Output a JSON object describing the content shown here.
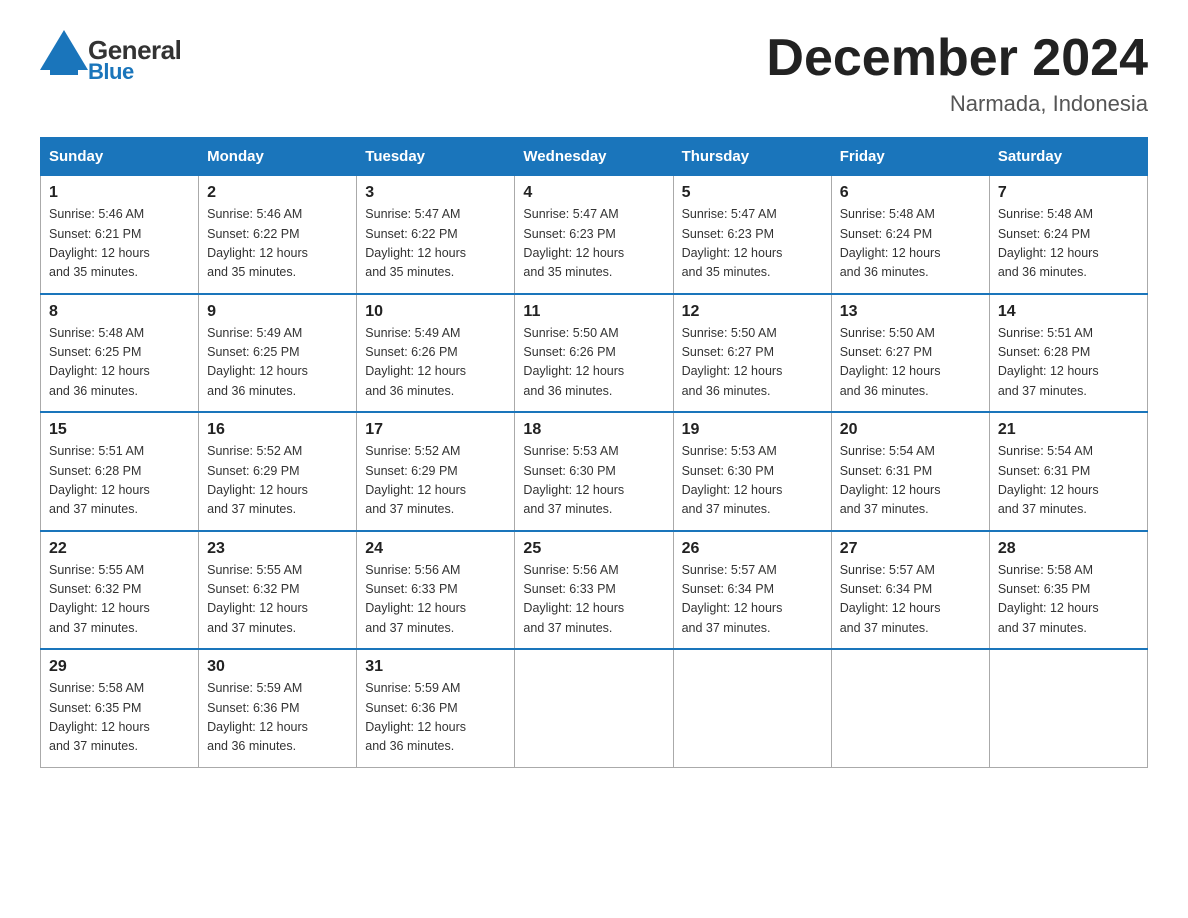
{
  "header": {
    "logo_general": "General",
    "logo_blue": "Blue",
    "month_title": "December 2024",
    "location": "Narmada, Indonesia"
  },
  "days_of_week": [
    "Sunday",
    "Monday",
    "Tuesday",
    "Wednesday",
    "Thursday",
    "Friday",
    "Saturday"
  ],
  "weeks": [
    [
      {
        "day": 1,
        "sunrise": "5:46 AM",
        "sunset": "6:21 PM",
        "daylight": "12 hours and 35 minutes."
      },
      {
        "day": 2,
        "sunrise": "5:46 AM",
        "sunset": "6:22 PM",
        "daylight": "12 hours and 35 minutes."
      },
      {
        "day": 3,
        "sunrise": "5:47 AM",
        "sunset": "6:22 PM",
        "daylight": "12 hours and 35 minutes."
      },
      {
        "day": 4,
        "sunrise": "5:47 AM",
        "sunset": "6:23 PM",
        "daylight": "12 hours and 35 minutes."
      },
      {
        "day": 5,
        "sunrise": "5:47 AM",
        "sunset": "6:23 PM",
        "daylight": "12 hours and 35 minutes."
      },
      {
        "day": 6,
        "sunrise": "5:48 AM",
        "sunset": "6:24 PM",
        "daylight": "12 hours and 36 minutes."
      },
      {
        "day": 7,
        "sunrise": "5:48 AM",
        "sunset": "6:24 PM",
        "daylight": "12 hours and 36 minutes."
      }
    ],
    [
      {
        "day": 8,
        "sunrise": "5:48 AM",
        "sunset": "6:25 PM",
        "daylight": "12 hours and 36 minutes."
      },
      {
        "day": 9,
        "sunrise": "5:49 AM",
        "sunset": "6:25 PM",
        "daylight": "12 hours and 36 minutes."
      },
      {
        "day": 10,
        "sunrise": "5:49 AM",
        "sunset": "6:26 PM",
        "daylight": "12 hours and 36 minutes."
      },
      {
        "day": 11,
        "sunrise": "5:50 AM",
        "sunset": "6:26 PM",
        "daylight": "12 hours and 36 minutes."
      },
      {
        "day": 12,
        "sunrise": "5:50 AM",
        "sunset": "6:27 PM",
        "daylight": "12 hours and 36 minutes."
      },
      {
        "day": 13,
        "sunrise": "5:50 AM",
        "sunset": "6:27 PM",
        "daylight": "12 hours and 36 minutes."
      },
      {
        "day": 14,
        "sunrise": "5:51 AM",
        "sunset": "6:28 PM",
        "daylight": "12 hours and 37 minutes."
      }
    ],
    [
      {
        "day": 15,
        "sunrise": "5:51 AM",
        "sunset": "6:28 PM",
        "daylight": "12 hours and 37 minutes."
      },
      {
        "day": 16,
        "sunrise": "5:52 AM",
        "sunset": "6:29 PM",
        "daylight": "12 hours and 37 minutes."
      },
      {
        "day": 17,
        "sunrise": "5:52 AM",
        "sunset": "6:29 PM",
        "daylight": "12 hours and 37 minutes."
      },
      {
        "day": 18,
        "sunrise": "5:53 AM",
        "sunset": "6:30 PM",
        "daylight": "12 hours and 37 minutes."
      },
      {
        "day": 19,
        "sunrise": "5:53 AM",
        "sunset": "6:30 PM",
        "daylight": "12 hours and 37 minutes."
      },
      {
        "day": 20,
        "sunrise": "5:54 AM",
        "sunset": "6:31 PM",
        "daylight": "12 hours and 37 minutes."
      },
      {
        "day": 21,
        "sunrise": "5:54 AM",
        "sunset": "6:31 PM",
        "daylight": "12 hours and 37 minutes."
      }
    ],
    [
      {
        "day": 22,
        "sunrise": "5:55 AM",
        "sunset": "6:32 PM",
        "daylight": "12 hours and 37 minutes."
      },
      {
        "day": 23,
        "sunrise": "5:55 AM",
        "sunset": "6:32 PM",
        "daylight": "12 hours and 37 minutes."
      },
      {
        "day": 24,
        "sunrise": "5:56 AM",
        "sunset": "6:33 PM",
        "daylight": "12 hours and 37 minutes."
      },
      {
        "day": 25,
        "sunrise": "5:56 AM",
        "sunset": "6:33 PM",
        "daylight": "12 hours and 37 minutes."
      },
      {
        "day": 26,
        "sunrise": "5:57 AM",
        "sunset": "6:34 PM",
        "daylight": "12 hours and 37 minutes."
      },
      {
        "day": 27,
        "sunrise": "5:57 AM",
        "sunset": "6:34 PM",
        "daylight": "12 hours and 37 minutes."
      },
      {
        "day": 28,
        "sunrise": "5:58 AM",
        "sunset": "6:35 PM",
        "daylight": "12 hours and 37 minutes."
      }
    ],
    [
      {
        "day": 29,
        "sunrise": "5:58 AM",
        "sunset": "6:35 PM",
        "daylight": "12 hours and 37 minutes."
      },
      {
        "day": 30,
        "sunrise": "5:59 AM",
        "sunset": "6:36 PM",
        "daylight": "12 hours and 36 minutes."
      },
      {
        "day": 31,
        "sunrise": "5:59 AM",
        "sunset": "6:36 PM",
        "daylight": "12 hours and 36 minutes."
      },
      null,
      null,
      null,
      null
    ]
  ],
  "labels": {
    "sunrise": "Sunrise:",
    "sunset": "Sunset:",
    "daylight": "Daylight:"
  }
}
